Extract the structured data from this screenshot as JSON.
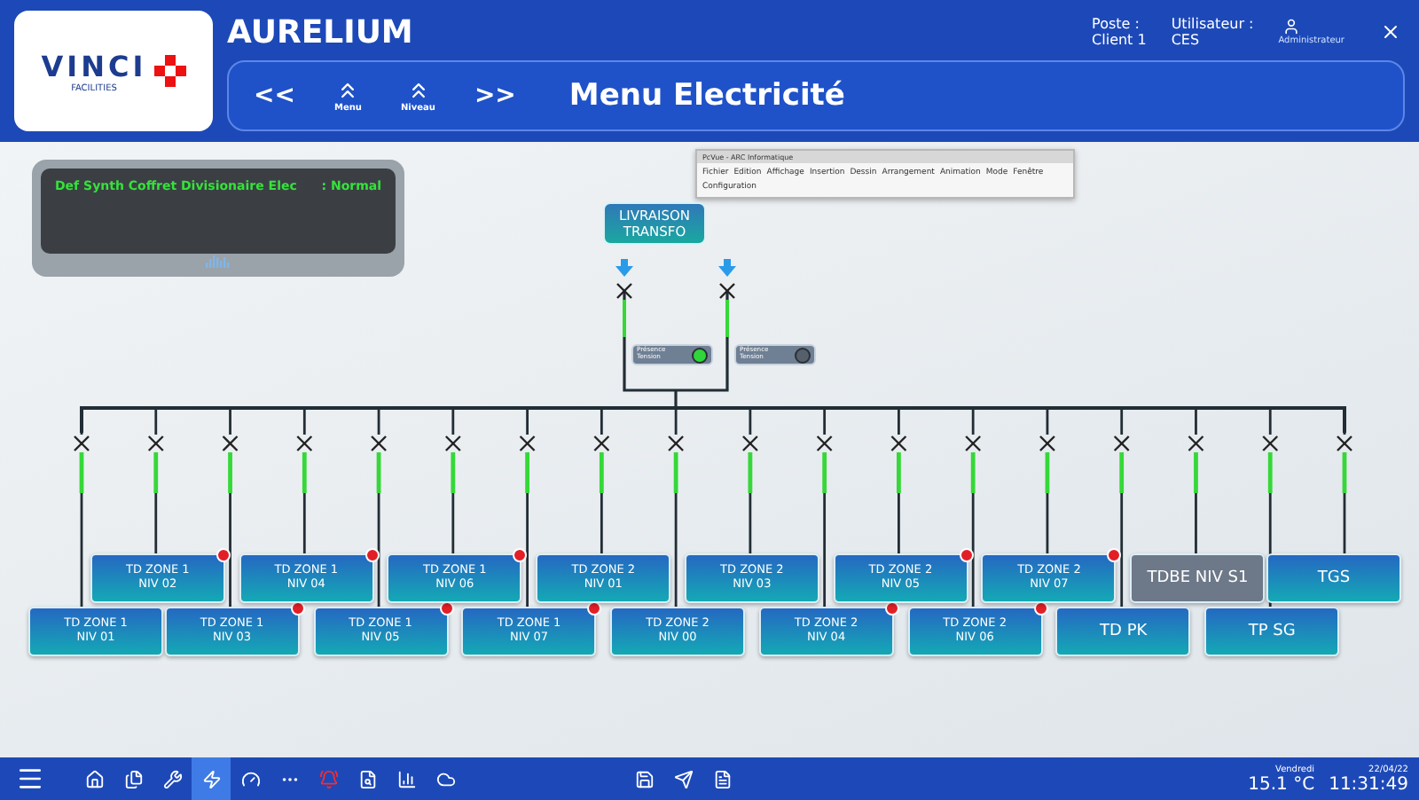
{
  "logo": {
    "brand": "VINCI",
    "sub": "FACILITIES"
  },
  "app_title": "AURELIUM",
  "session": {
    "poste_label": "Poste :",
    "poste": "Client 1",
    "user_label": "Utilisateur :",
    "user": "CES",
    "role": "Administrateur"
  },
  "nav": [
    {
      "kind": "back",
      "label": "<<"
    },
    {
      "kind": "up",
      "caption": "Menu"
    },
    {
      "kind": "up",
      "caption": "Niveau"
    },
    {
      "kind": "forward",
      "label": ">>"
    }
  ],
  "page_title": "Menu Electricité",
  "editor_window": {
    "title": "PcVue - ARC Informatique",
    "menus": [
      "Fichier",
      "Edition",
      "Affichage",
      "Insertion",
      "Dessin",
      "Arrangement",
      "Animation",
      "Mode",
      "Fenêtre",
      "Configuration"
    ]
  },
  "status_panel": {
    "label": "Def Synth Coffret Divisionaire Elec",
    "value": ": Normal"
  },
  "source": {
    "label": "LIVRAISON TRANSFO",
    "inputs": [
      {
        "label": "Présence Tension",
        "on": true
      },
      {
        "label": "Présence Tension",
        "on": false
      }
    ]
  },
  "feeders": [
    {
      "line1": "TD ZONE 1",
      "line2": "NIV 01",
      "raised": false,
      "alarm": false,
      "kind": "normal",
      "energized": true
    },
    {
      "line1": "TD ZONE 1",
      "line2": "NIV 02",
      "raised": true,
      "alarm": true,
      "kind": "normal",
      "energized": true
    },
    {
      "line1": "TD ZONE 1",
      "line2": "NIV 03",
      "raised": false,
      "alarm": true,
      "kind": "normal",
      "energized": true
    },
    {
      "line1": "TD ZONE 1",
      "line2": "NIV 04",
      "raised": true,
      "alarm": true,
      "kind": "normal",
      "energized": true
    },
    {
      "line1": "TD ZONE 1",
      "line2": "NIV 05",
      "raised": false,
      "alarm": true,
      "kind": "normal",
      "energized": true
    },
    {
      "line1": "TD ZONE 1",
      "line2": "NIV 06",
      "raised": true,
      "alarm": true,
      "kind": "normal",
      "energized": true
    },
    {
      "line1": "TD ZONE 1",
      "line2": "NIV 07",
      "raised": false,
      "alarm": true,
      "kind": "normal",
      "energized": true
    },
    {
      "line1": "TD ZONE 2",
      "line2": "NIV 01",
      "raised": true,
      "alarm": false,
      "kind": "normal",
      "energized": true
    },
    {
      "line1": "TD ZONE 2",
      "line2": "NIV 00",
      "raised": false,
      "alarm": false,
      "kind": "normal",
      "energized": true
    },
    {
      "line1": "TD ZONE 2",
      "line2": "NIV 03",
      "raised": true,
      "alarm": false,
      "kind": "normal",
      "energized": true
    },
    {
      "line1": "TD ZONE 2",
      "line2": "NIV 04",
      "raised": false,
      "alarm": true,
      "kind": "normal",
      "energized": true
    },
    {
      "line1": "TD ZONE 2",
      "line2": "NIV 05",
      "raised": true,
      "alarm": true,
      "kind": "normal",
      "energized": true
    },
    {
      "line1": "TD ZONE 2",
      "line2": "NIV 06",
      "raised": false,
      "alarm": true,
      "kind": "normal",
      "energized": true
    },
    {
      "line1": "TD ZONE 2",
      "line2": "NIV 07",
      "raised": true,
      "alarm": true,
      "kind": "normal",
      "energized": true
    },
    {
      "line1": "TD PK",
      "raised": false,
      "alarm": false,
      "kind": "normal",
      "energized": true
    },
    {
      "line1": "TDBE NIV S1",
      "raised": true,
      "alarm": false,
      "kind": "offline",
      "energized": true
    },
    {
      "line1": "TP SG",
      "raised": false,
      "alarm": false,
      "kind": "normal",
      "energized": true
    },
    {
      "line1": "TGS",
      "raised": true,
      "alarm": false,
      "kind": "normal",
      "energized": true
    }
  ],
  "toolbar": [
    {
      "kind": "home",
      "selected": false
    },
    {
      "kind": "documents",
      "selected": false
    },
    {
      "kind": "tools",
      "selected": false
    },
    {
      "kind": "electricity",
      "selected": true
    },
    {
      "kind": "gauge",
      "selected": false
    },
    {
      "kind": "more",
      "selected": false
    },
    {
      "kind": "alarm",
      "selected": false
    },
    {
      "kind": "report",
      "selected": false
    },
    {
      "kind": "chart",
      "selected": false
    },
    {
      "kind": "cloud",
      "selected": false
    }
  ],
  "toolbar_center": [
    {
      "kind": "save"
    },
    {
      "kind": "send"
    },
    {
      "kind": "document"
    }
  ],
  "clock": {
    "day": "Vendredi",
    "date": "22/04/22",
    "temperature": "15.1 °C",
    "time": "11:31:49"
  }
}
